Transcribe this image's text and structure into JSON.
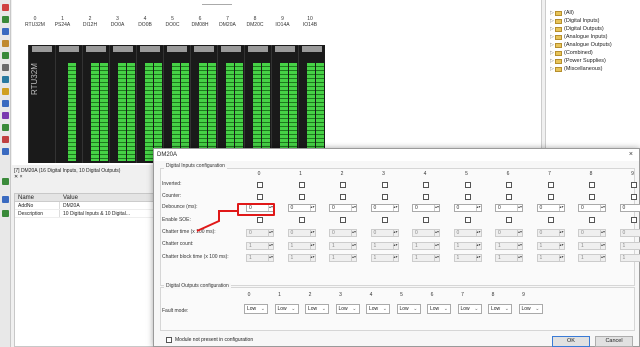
{
  "rack": {
    "slots": [
      {
        "num": "0",
        "name": "RTU32M"
      },
      {
        "num": "1",
        "name": "PS24A"
      },
      {
        "num": "2",
        "name": "DI12H"
      },
      {
        "num": "3",
        "name": "DO0A"
      },
      {
        "num": "4",
        "name": "DO0B"
      },
      {
        "num": "5",
        "name": "DO0C"
      },
      {
        "num": "6",
        "name": "DM08H"
      },
      {
        "num": "7",
        "name": "DM20A"
      },
      {
        "num": "8",
        "name": "DM20C"
      },
      {
        "num": "9",
        "name": "IO14A"
      },
      {
        "num": "10",
        "name": "IO14B"
      }
    ],
    "cpu_label": "RTU32M"
  },
  "tree": {
    "items": [
      "(All)",
      "(Digital Inputs)",
      "(Digital Outputs)",
      "(Analogue Inputs)",
      "(Analogue Outputs)",
      "(Combined)",
      "(Power Supplies)",
      "(Miscellaneous)"
    ]
  },
  "status": {
    "line1": "[7] DM20A (16 Digital Inputs, 10 Digital Outputs)",
    "line2": "✕  ×"
  },
  "props": {
    "col_name": "Name",
    "col_value": "Value",
    "rows": [
      {
        "name": "AddNo",
        "value": "DM20A"
      },
      {
        "name": "Description",
        "value": "10 Digital Inputs & 10 Digital..."
      }
    ]
  },
  "dialog": {
    "title": "DM20A",
    "close": "×",
    "inputs_group": "Digital Inputs configuration",
    "outputs_group": "Digital Outputs configuration",
    "columns": [
      "0",
      "1",
      "2",
      "3",
      "4",
      "5",
      "6",
      "7",
      "8",
      "9"
    ],
    "row_labels": [
      "Inverted:",
      "Counter:",
      "Debounce (ms):",
      "Enable SOE:",
      "Chatter time (x 100 ms):",
      "Chatter count:",
      "Chatter block time (x 100 ms):"
    ],
    "debounce_value": "0",
    "chatter_value": "0",
    "chatter_disabled_value": "1",
    "fault_mode_label": "Fault mode:",
    "fault_mode_value": "Low",
    "module_checkbox": "Module not present in configuration",
    "ok": "OK",
    "cancel": "Cancel",
    "highlight_color": "#e01818"
  }
}
